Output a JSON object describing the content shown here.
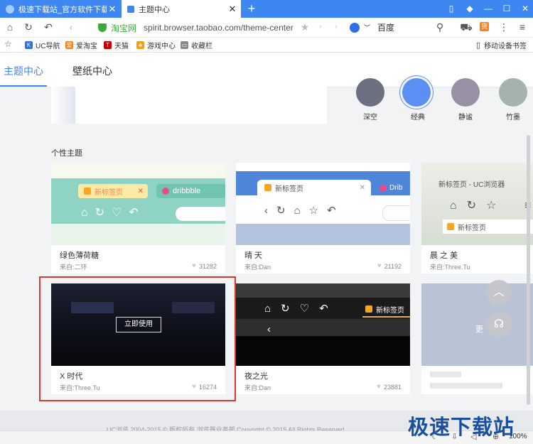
{
  "tabs": [
    {
      "label": "极速下载站_官方软件下载_绿",
      "active": false
    },
    {
      "label": "主题中心",
      "active": true
    }
  ],
  "window_controls": [
    "▯",
    "◆",
    "—",
    "☐",
    "✕"
  ],
  "address": {
    "site_name": "淘宝网",
    "url": "spirit.browser.taobao.com/theme-center",
    "search_engine": "百度"
  },
  "bookmarks": [
    {
      "label": "UC导航",
      "color": "#2f6fe0",
      "glyph": "K"
    },
    {
      "label": "爱淘宝",
      "color": "#f58220",
      "glyph": "爱"
    },
    {
      "label": "天猫",
      "color": "#c40000",
      "glyph": "T"
    },
    {
      "label": "游戏中心",
      "color": "#f0a020",
      "glyph": "♣"
    },
    {
      "label": "收藏栏",
      "color": "#888888",
      "glyph": "▭"
    }
  ],
  "mobile_bookmarks": "移动设备书签",
  "nav": {
    "theme_center": "主题中心",
    "wallpaper_center": "壁纸中心"
  },
  "color_themes": [
    {
      "label": "深空",
      "color": "#6b7180"
    },
    {
      "label": "经典",
      "color": "#5b8ff3"
    },
    {
      "label": "静谧",
      "color": "#9a90a6"
    },
    {
      "label": "竹墨",
      "color": "#a4b4ac"
    }
  ],
  "section_title": "个性主题",
  "themes": [
    {
      "name": "绿色薄荷糖",
      "source": "来自:二环",
      "likes": "31282",
      "tab1": "新标签页",
      "tab2": "dribbble"
    },
    {
      "name": "晴 天",
      "source": "来自:Dan",
      "likes": "21192",
      "tab1": "新标签页",
      "tab2": "Drib"
    },
    {
      "name": "晨 之 美",
      "source": "来自:Three.Tu",
      "likes": "",
      "window_title": "新标签页 - UC浏览器",
      "tab1": "新标签页"
    },
    {
      "name": "X 时代",
      "source": "来自:Three.Tu",
      "likes": "16274",
      "button": "立即使用"
    },
    {
      "name": "夜之光",
      "source": "来自:Dan",
      "likes": "23881",
      "tab1": "新标签页"
    },
    {
      "name": "",
      "source": "",
      "likes": "",
      "overlay": "更"
    }
  ],
  "float_buttons": {
    "up": "︿",
    "support": "☊"
  },
  "footer_text": "UC浏览 2004-2015 © 版权所有 浏览器业务部 Copyright © 2015 All Rights Reserved",
  "status": {
    "zoom": "100%"
  },
  "watermark": "极速下载站",
  "colors": {
    "accent": "#3e86f0",
    "highlight_box": "#d9382f"
  }
}
